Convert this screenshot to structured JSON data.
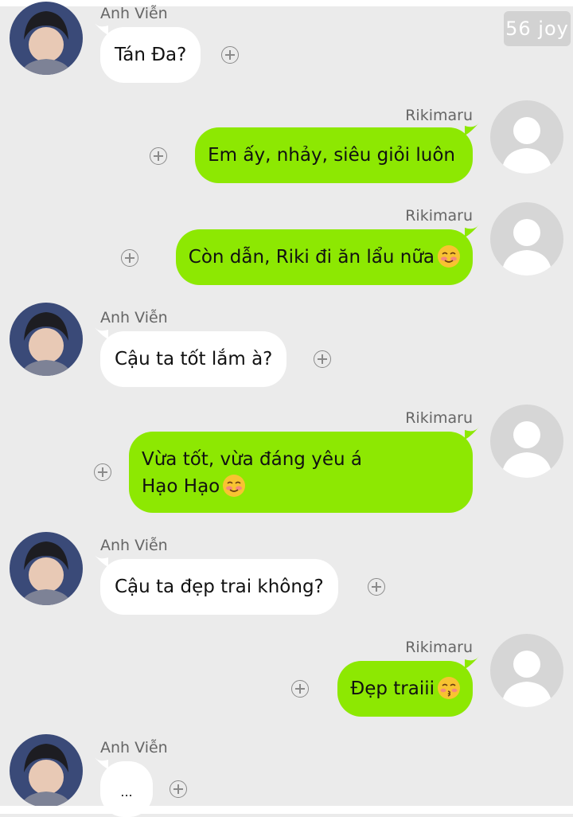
{
  "watermark": "56 joy",
  "contacts": {
    "left": "Anh Viễn",
    "right": "Rikimaru"
  },
  "messages": [
    {
      "side": "in",
      "text": "Tán Đa?"
    },
    {
      "side": "out",
      "text": "Em ấy, nhảy, siêu giỏi luôn"
    },
    {
      "side": "out",
      "text": "Còn dẫn, Riki đi ăn lẩu nữa",
      "emoji": "smiling-blush-emoji"
    },
    {
      "side": "in",
      "text": "Cậu ta tốt lắm à?"
    },
    {
      "side": "out",
      "lines": [
        "Vừa tốt, vừa đáng yêu á",
        "Hạo Hạo"
      ],
      "emoji": "smiling-blush-emoji"
    },
    {
      "side": "in",
      "text": "Cậu ta đẹp trai không?"
    },
    {
      "side": "out",
      "text": "Đẹp traiii",
      "emoji": "kissing-emoji"
    },
    {
      "side": "in",
      "text": "..."
    }
  ],
  "colors": {
    "background": "#ebebeb",
    "incoming_bubble": "#ffffff",
    "outgoing_bubble": "#8de802"
  }
}
